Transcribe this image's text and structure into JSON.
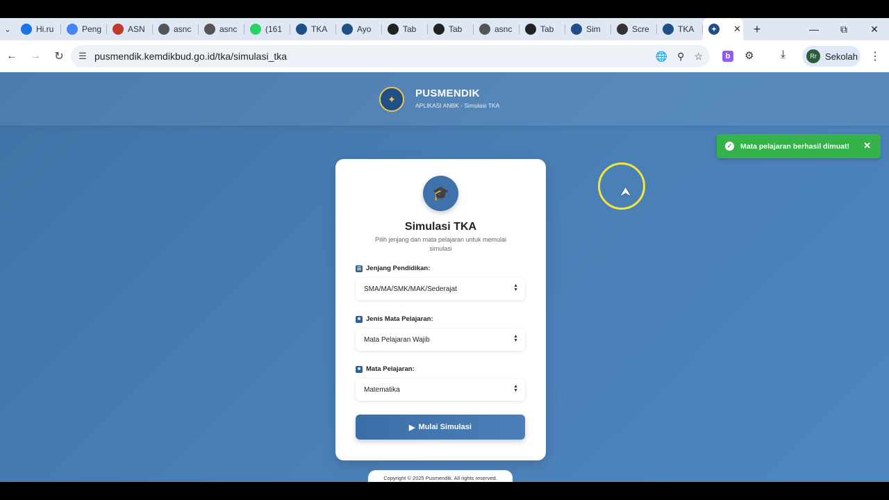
{
  "browser": {
    "tabs": [
      {
        "label": "Hi.ru",
        "icon": "hi-icon",
        "color": "#1a73e8"
      },
      {
        "label": "Peng",
        "icon": "docs-icon",
        "color": "#4285f4"
      },
      {
        "label": "ASN",
        "icon": "asn-icon",
        "color": "#c0392b"
      },
      {
        "label": "asnc",
        "icon": "globe-icon",
        "color": "#555555"
      },
      {
        "label": "asnc",
        "icon": "globe-icon",
        "color": "#555555"
      },
      {
        "label": "(161",
        "icon": "whatsapp-icon",
        "color": "#25d366"
      },
      {
        "label": "TKA",
        "icon": "kemdikbud-icon",
        "color": "#1f4f86"
      },
      {
        "label": "Ayo",
        "icon": "kemdikbud-icon",
        "color": "#1f4f86"
      },
      {
        "label": "Tab",
        "icon": "github-icon",
        "color": "#222222"
      },
      {
        "label": "Tab",
        "icon": "github-icon",
        "color": "#222222"
      },
      {
        "label": "asnc",
        "icon": "globe-icon",
        "color": "#555555"
      },
      {
        "label": "Tab",
        "icon": "github-icon",
        "color": "#222222"
      },
      {
        "label": "Sim",
        "icon": "kemdikbud-icon",
        "color": "#1f4f86"
      },
      {
        "label": "Scre",
        "icon": "screen-icon",
        "color": "#333333"
      },
      {
        "label": "TKA",
        "icon": "kemdikbud-icon",
        "color": "#1f4f86"
      }
    ],
    "url": "pusmendik.kemdikbud.go.id/tka/simulasi_tka",
    "profile_initials": "Rr",
    "profile_name": "Sekolah",
    "ext_letter": "b"
  },
  "header": {
    "brand": "PUSMENDIK",
    "subtitle": "APLIKASI ANBK - Simulasi TKA"
  },
  "card": {
    "title": "Simulasi TKA",
    "subtitle": "Pilih jenjang dan mata pelajaran untuk memulai simulasi",
    "fields": [
      {
        "label": "Jenjang Pendidikan:",
        "value": "SMA/MA/SMK/MAK/Sederajat"
      },
      {
        "label": "Jenis Mata Pelajaran:",
        "value": "Mata Pelajaran Wajib"
      },
      {
        "label": "Mata Pelajaran:",
        "value": "Matematika"
      }
    ],
    "start_button": "Mulai Simulasi"
  },
  "footer": {
    "text": "Copyright © 2025 Pusmendik. All rights reserved."
  },
  "toast": {
    "message": "Mata pelajaran berhasil dimuat!"
  },
  "colors": {
    "page_bg": "#4a7fb5",
    "toast_bg": "#35b24a",
    "accent": "#3d72ab",
    "cursor_ring": "#f4e53c"
  }
}
